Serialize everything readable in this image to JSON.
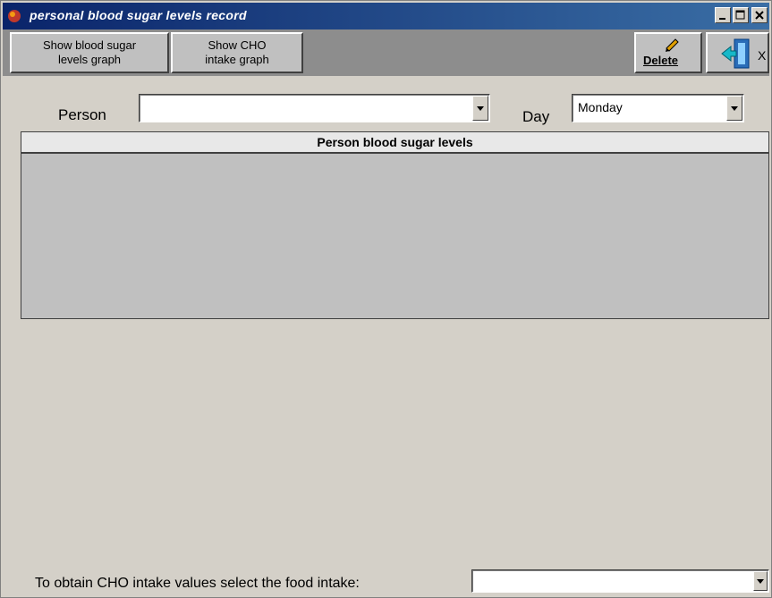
{
  "window": {
    "title": "personal blood sugar levels record"
  },
  "toolbar": {
    "show_bsl_line1": "Show blood sugar",
    "show_bsl_line2": "levels graph",
    "show_cho_line1": "Show CHO",
    "show_cho_line2": "intake graph",
    "delete_label": "Delete",
    "exit_label": "X"
  },
  "filters": {
    "person_label": "Person",
    "person_value": "",
    "day_label": "Day",
    "day_value": "Monday"
  },
  "grid": {
    "header": "Person blood sugar levels"
  },
  "footer": {
    "food_label": "To obtain CHO intake values select the food intake:",
    "food_value": ""
  },
  "colors": {
    "titlebar": "#0a246a",
    "toolbar": "#8d8d8d",
    "grid": "#c0c0c0",
    "face": "#d4d0c8"
  }
}
